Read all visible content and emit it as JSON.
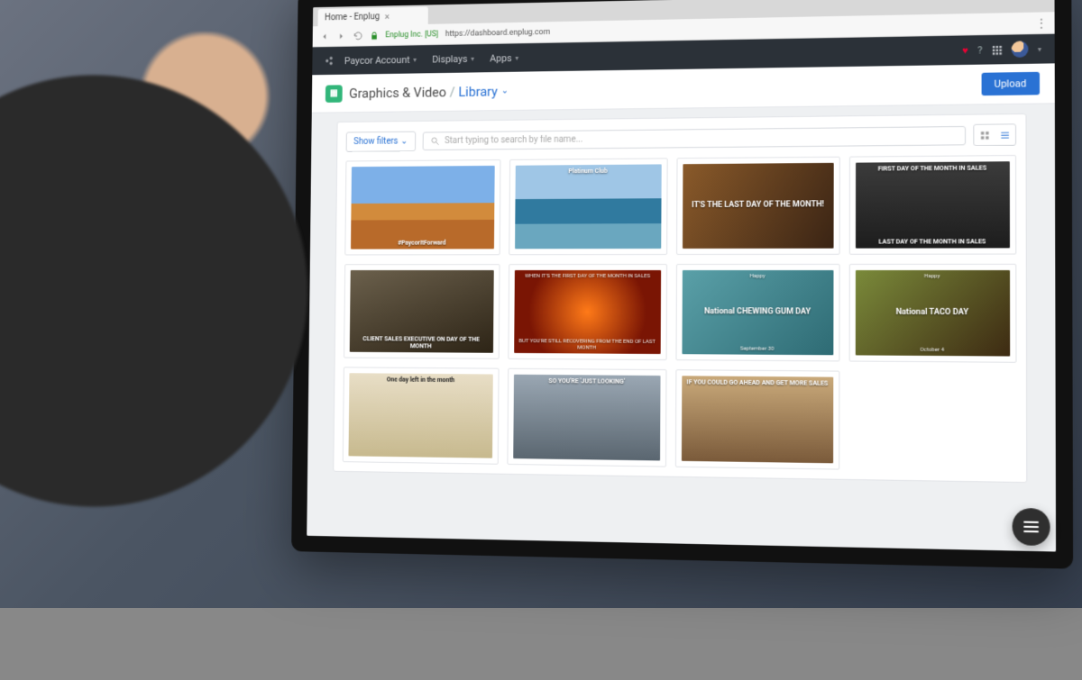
{
  "browser": {
    "tab_title": "Home - Enplug",
    "secure_label": "Enplug Inc. [US]",
    "url": "https://dashboard.enplug.com"
  },
  "header": {
    "account": "Paycor Account",
    "nav": {
      "displays": "Displays",
      "apps": "Apps"
    }
  },
  "breadcrumb": {
    "section": "Graphics & Video",
    "page": "Library"
  },
  "actions": {
    "upload": "Upload",
    "show_filters": "Show filters"
  },
  "search": {
    "placeholder": "Start typing to search by file name..."
  },
  "library": [
    {
      "caption_bottom": "#PaycorItForward"
    },
    {
      "caption_top": "Platinum Club"
    },
    {
      "caption_mid": "IT'S THE LAST DAY OF THE MONTH!"
    },
    {
      "caption_top": "FIRST DAY OF THE MONTH IN SALES",
      "caption_bottom": "LAST DAY OF THE MONTH IN SALES"
    },
    {
      "caption_bottom": "CLIENT SALES EXECUTIVE ON DAY OF THE MONTH"
    },
    {
      "caption_top": "WHEN IT'S THE FIRST DAY OF THE MONTH IN SALES",
      "caption_bottom": "BUT YOU'RE STILL RECOVERING FROM THE END OF LAST MONTH"
    },
    {
      "caption_small_top": "Happy",
      "caption_mid": "National CHEWING GUM DAY",
      "caption_small_bottom": "September 30"
    },
    {
      "caption_small_top": "Happy",
      "caption_mid": "National TACO DAY",
      "caption_small_bottom": "October 4"
    },
    {
      "caption_top": "One day left in the month"
    },
    {
      "caption_top": "SO YOU'RE 'JUST LOOKING'"
    },
    {
      "caption_top": "IF YOU COULD GO AHEAD AND GET MORE SALES"
    }
  ]
}
